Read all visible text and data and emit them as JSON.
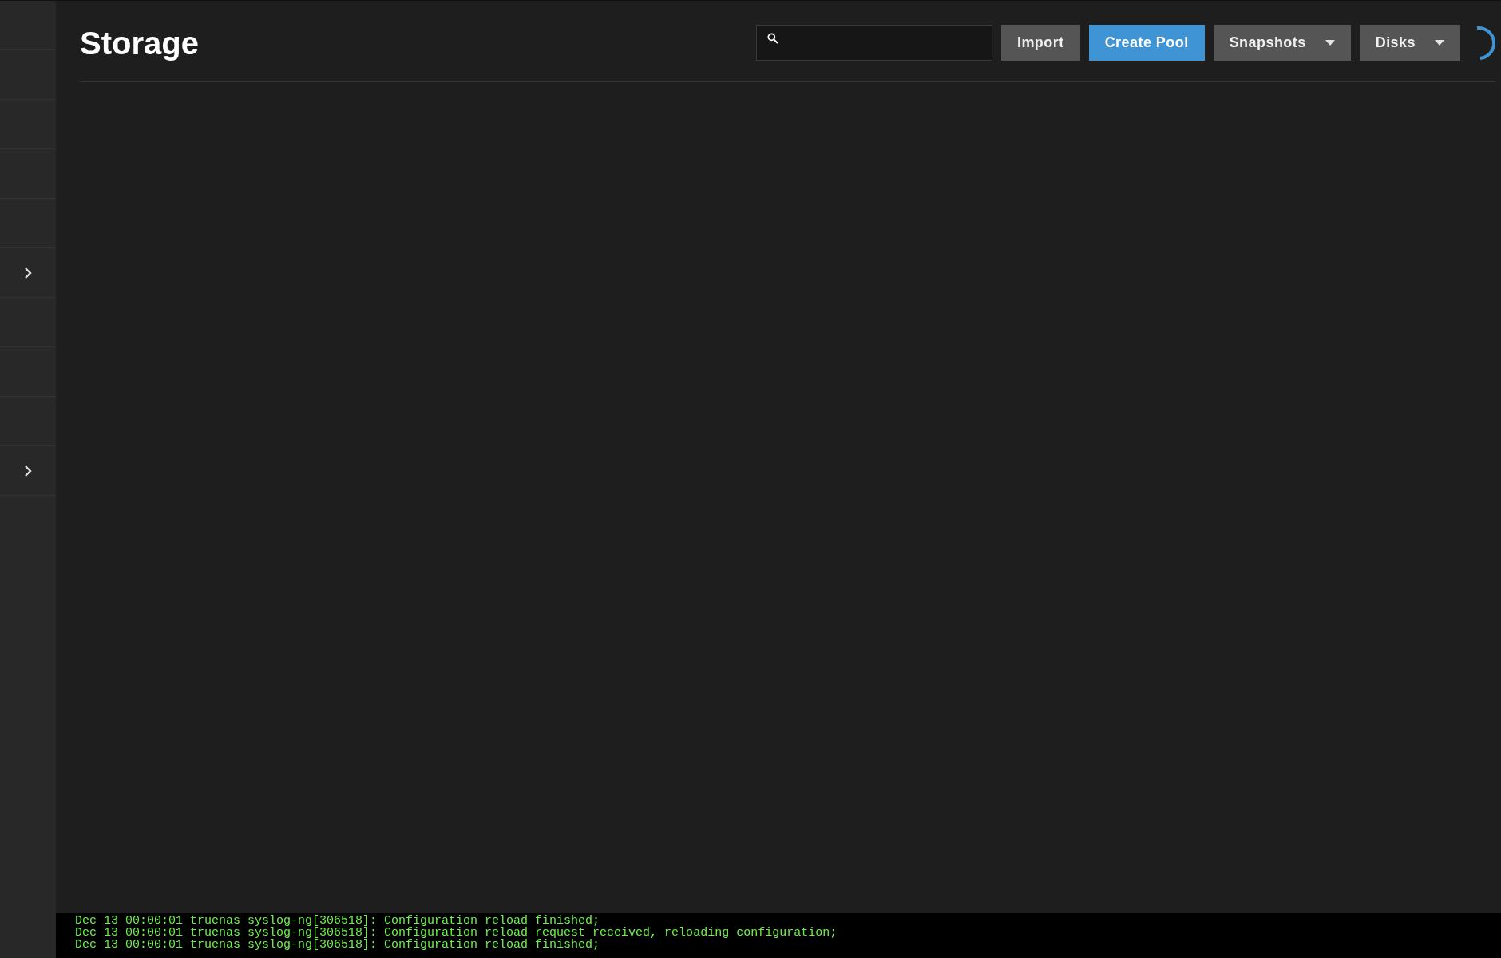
{
  "sidebar": {
    "items": [
      {
        "kind": "plain"
      },
      {
        "kind": "plain"
      },
      {
        "kind": "plain"
      },
      {
        "kind": "plain"
      },
      {
        "kind": "plain"
      },
      {
        "kind": "expandable"
      },
      {
        "kind": "plain"
      },
      {
        "kind": "plain"
      },
      {
        "kind": "plain"
      },
      {
        "kind": "expandable"
      }
    ]
  },
  "page": {
    "title": "Storage"
  },
  "toolbar": {
    "buttons": [
      {
        "label": "Import",
        "kind": "plain"
      },
      {
        "label": "Create Pool",
        "kind": "primary"
      },
      {
        "label": "Snapshots",
        "kind": "menu"
      },
      {
        "label": "Disks",
        "kind": "menu"
      }
    ]
  },
  "console": {
    "lines": [
      "Dec 13 00:00:01 truenas syslog-ng[306518]: Configuration reload finished;",
      "Dec 13 00:00:01 truenas syslog-ng[306518]: Configuration reload request received, reloading configuration;",
      "Dec 13 00:00:01 truenas syslog-ng[306518]: Configuration reload finished;"
    ]
  }
}
